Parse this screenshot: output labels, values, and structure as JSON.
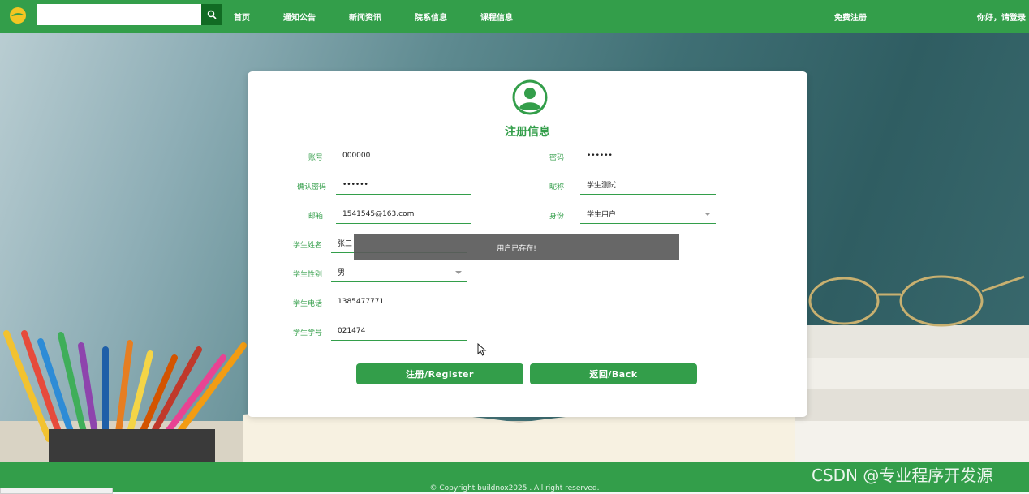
{
  "colors": {
    "brand": "#339e4a",
    "brand_dark": "#116b23",
    "toast_bg": "#5a5a5a"
  },
  "header": {
    "search_placeholder": "",
    "nav": [
      "首页",
      "通知公告",
      "新闻资讯",
      "院系信息",
      "课程信息"
    ],
    "register": "免费注册",
    "login": "你好，请登录"
  },
  "form": {
    "title": "注册信息",
    "fields": {
      "account": {
        "label": "账号",
        "value": "000000"
      },
      "password": {
        "label": "密码",
        "value": "••••••"
      },
      "confirm_password": {
        "label": "确认密码",
        "value": "••••••"
      },
      "nickname": {
        "label": "昵称",
        "value": "学生测试"
      },
      "email": {
        "label": "邮箱",
        "value": "1541545@163.com"
      },
      "role": {
        "label": "身份",
        "value": "学生用户"
      },
      "student_name": {
        "label": "学生姓名",
        "value": "张三"
      },
      "student_gender": {
        "label": "学生性别",
        "value": "男"
      },
      "student_phone": {
        "label": "学生电话",
        "value": "1385477771"
      },
      "student_id": {
        "label": "学生学号",
        "value": "021474"
      }
    },
    "register_button": "注册/Register",
    "back_button": "返回/Back"
  },
  "toast": "用户已存在!",
  "footer": {
    "copyright": "© Copyright buildnox2025 . All right reserved."
  },
  "watermark": "CSDN @专业程序开发源"
}
